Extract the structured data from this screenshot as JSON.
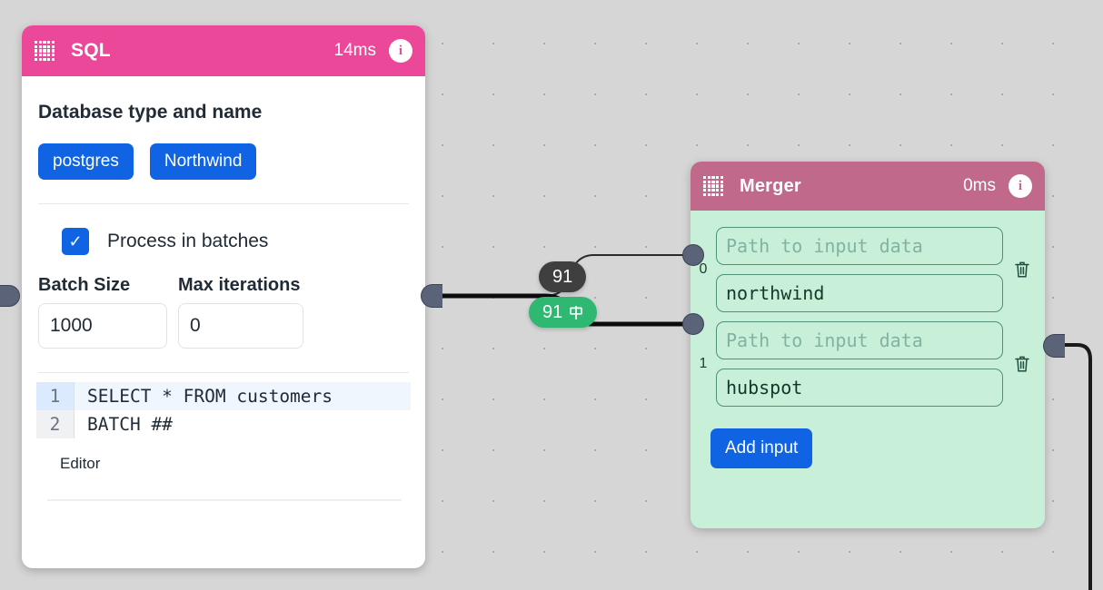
{
  "canvas": {
    "background_color": "#d6d6d6",
    "dot_color": "#a8a8a8"
  },
  "nodes": [
    {
      "id": "sql",
      "title": "SQL",
      "duration": "14ms",
      "header_color": "#ec4899",
      "info_icon": "info-icon",
      "drag_icon": "drag-handle-icon",
      "section_title": "Database type and name",
      "chips": [
        {
          "label": "postgres"
        },
        {
          "label": "Northwind"
        }
      ],
      "checkbox": {
        "label": "Process in batches",
        "checked": true,
        "check_glyph": "✓"
      },
      "fields": [
        {
          "label": "Batch Size",
          "value": "1000"
        },
        {
          "label": "Max iterations",
          "value": "0"
        }
      ],
      "code": {
        "lines": [
          {
            "number": "1",
            "text": "SELECT * FROM customers",
            "active": true
          },
          {
            "number": "2",
            "text": "BATCH ##",
            "active": false
          }
        ],
        "caption": "Editor"
      }
    },
    {
      "id": "merger",
      "title": "Merger",
      "duration": "0ms",
      "header_color": "#c0698a",
      "body_color": "#c8efd8",
      "info_icon": "info-icon",
      "drag_icon": "drag-handle-icon",
      "inputs": [
        {
          "index": "0",
          "path_placeholder": "Path to input data",
          "path_value": "",
          "name_value": "northwind",
          "delete_icon": "trash-icon"
        },
        {
          "index": "1",
          "path_placeholder": "Path to input data",
          "path_value": "",
          "name_value": "hubspot",
          "delete_icon": "trash-icon"
        }
      ],
      "add_button": "Add input"
    }
  ],
  "edge_badges": [
    {
      "id": "badge-top",
      "count": "91",
      "style": "dark",
      "icon": null
    },
    {
      "id": "badge-bottom",
      "count": "91",
      "style": "green",
      "icon": "signpost-icon"
    }
  ],
  "colors": {
    "accent_blue": "#1064e4",
    "sql_pink": "#ec4899",
    "merger_rose": "#c0698a",
    "merger_green": "#c8efd8",
    "badge_dark": "#3f3f3f",
    "badge_green": "#2eb872",
    "handle": "#5a6377"
  }
}
